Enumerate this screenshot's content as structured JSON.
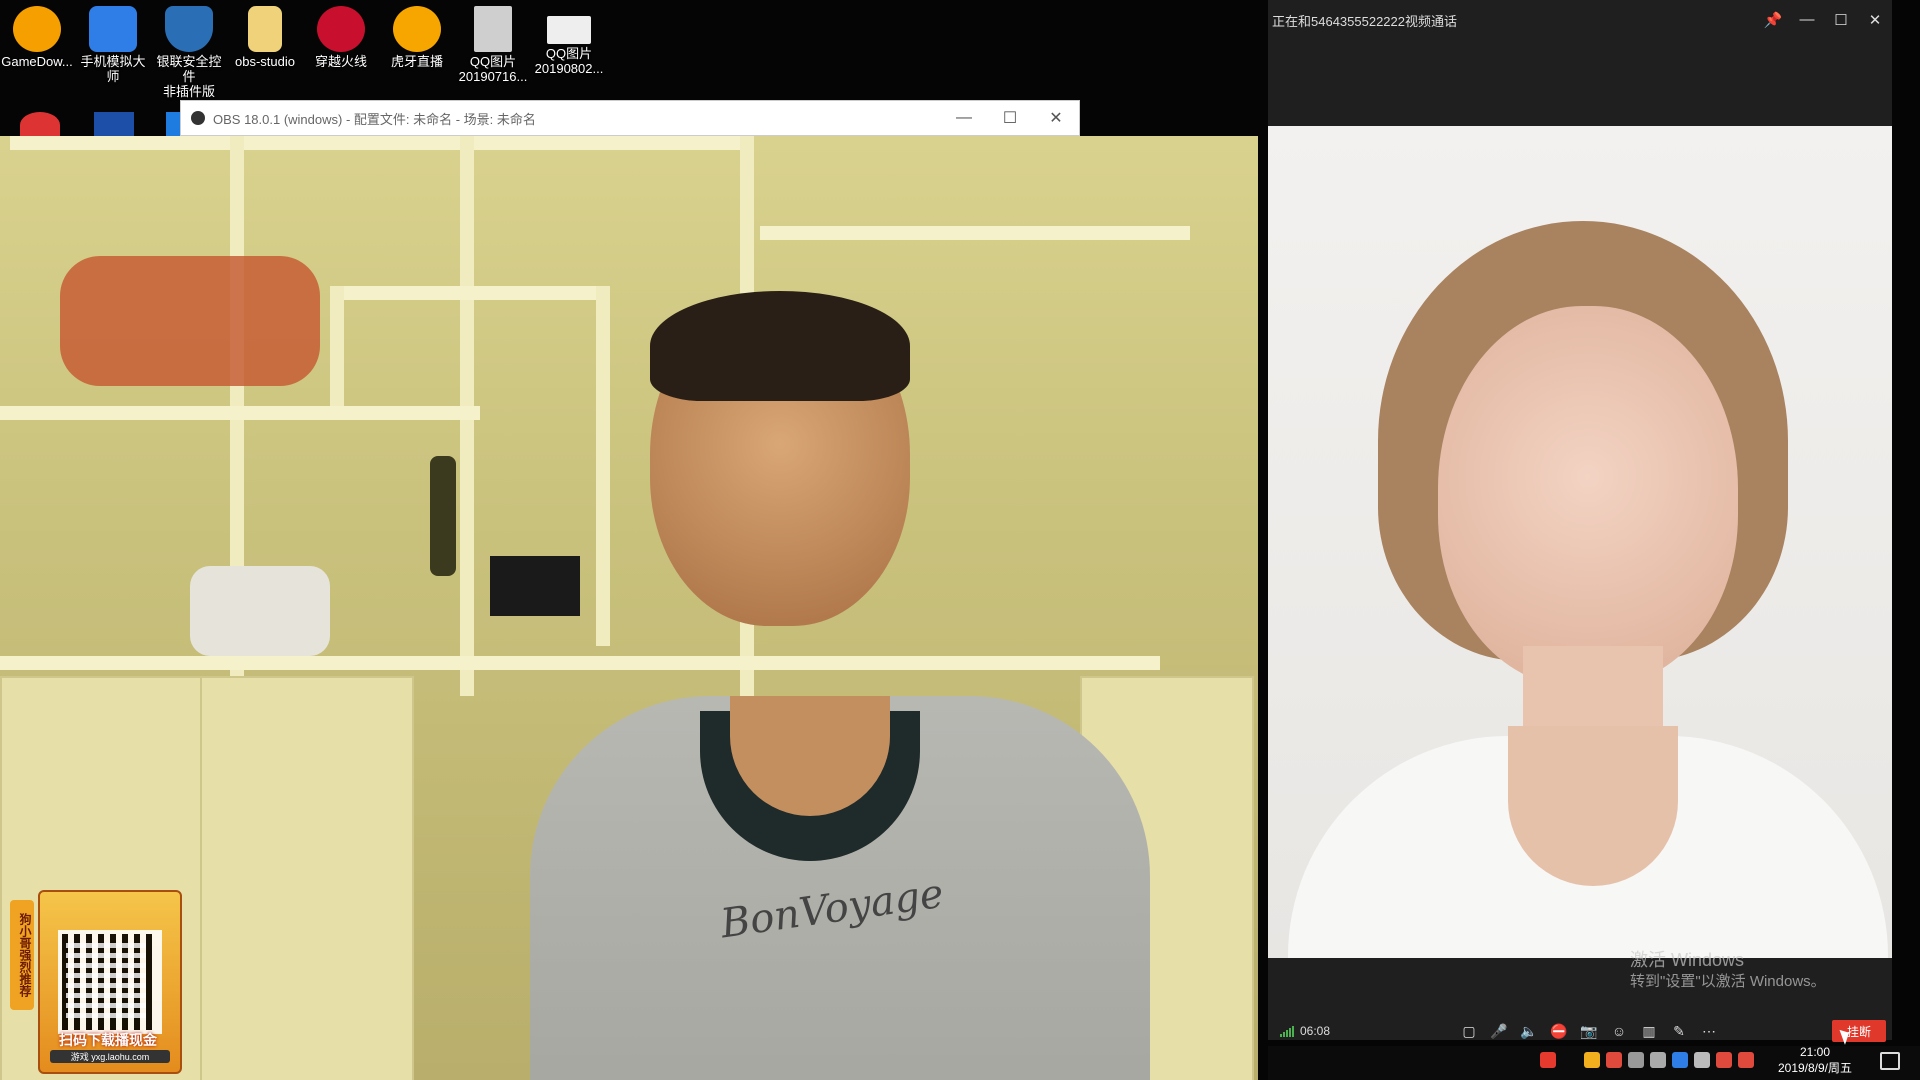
{
  "desktop": {
    "icons": [
      {
        "label": "GameDow...",
        "icon": "gamedownload-icon",
        "color": "#f5a000"
      },
      {
        "label": "手机模拟大师",
        "icon": "phone-emulator-icon",
        "color": "#2f7ee8"
      },
      {
        "label": "银联安全控件非插件版",
        "label_line1": "银联安全控件",
        "label_line2": "非插件版",
        "icon": "shield-icon",
        "color": "#2a6fb5"
      },
      {
        "label": "obs-studio",
        "icon": "folder-icon",
        "color": "#f0d27a"
      },
      {
        "label": "穿越火线",
        "icon": "crossfire-icon",
        "color": "#c8102e"
      },
      {
        "label": "虎牙直播",
        "icon": "huya-icon",
        "color": "#f7a600"
      },
      {
        "label": "QQ图片20190716...",
        "label_line1": "QQ图片",
        "label_line2": "20190716...",
        "icon": "image-icon",
        "color": "#cfcfcf"
      },
      {
        "label": "QQ图片20190802...",
        "label_line1": "QQ图片",
        "label_line2": "20190802...",
        "icon": "image-icon",
        "color": "#eeeeee"
      }
    ]
  },
  "obs": {
    "title": "OBS 18.0.1 (windows) - 配置文件: 未命名 - 场景: 未命名",
    "min_glyph": "—",
    "max_glyph": "☐",
    "close_glyph": "✕"
  },
  "promo": {
    "side_text": "狗小哥强烈推荐",
    "main_text": "扫码下载播现金",
    "url": "游戏 yxg.laohu.com"
  },
  "shirt_text": "BonVoyage",
  "call": {
    "title": "正在和5464355522222视频通话",
    "pin_glyph": "📌",
    "min_glyph": "—",
    "max_glyph": "☐",
    "close_glyph": "✕",
    "duration": "06:08",
    "hangup_label": "挂断",
    "watermark_line1": "激活 Windows",
    "watermark_line2": "转到\"设置\"以激活 Windows。",
    "tools": [
      "fullscreen-icon",
      "microphone-icon",
      "speaker-icon",
      "camera-off-icon",
      "screenshot-icon",
      "effects-icon",
      "layout-icon",
      "note-icon",
      "more-icon"
    ],
    "tool_glyphs": [
      "▢",
      "🎤",
      "🔈",
      "⛔",
      "📷",
      "☺",
      "▥",
      "✎",
      "⋯"
    ]
  },
  "taskbar": {
    "time": "21:00",
    "date": "2019/8/9/周五"
  },
  "colors": {
    "hangup": "#e0392c",
    "signal": "#4caf50"
  }
}
